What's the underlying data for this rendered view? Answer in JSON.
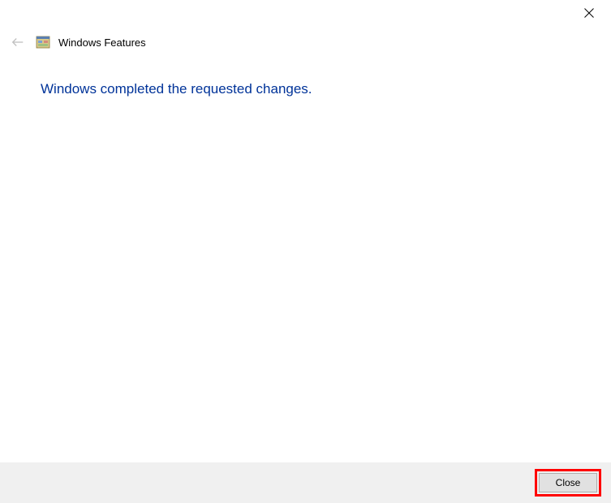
{
  "window": {
    "title": "Windows Features"
  },
  "content": {
    "message": "Windows completed the requested changes."
  },
  "footer": {
    "close_label": "Close"
  }
}
